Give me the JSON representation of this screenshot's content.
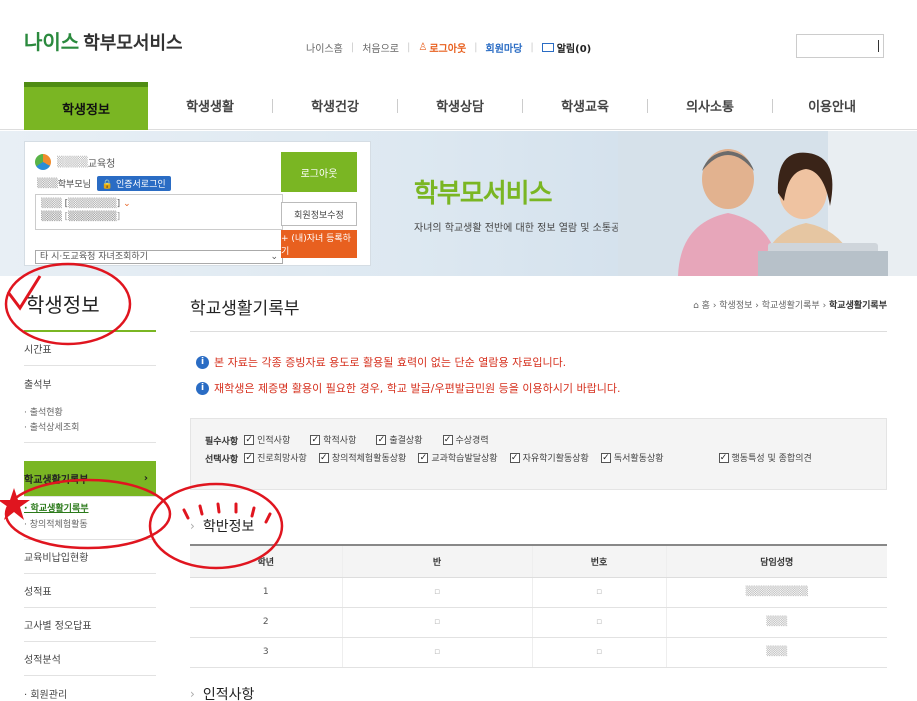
{
  "header": {
    "logo_neis": "나이스",
    "logo_service": "학부모서비스",
    "util": [
      "나이스홈",
      "처음으로",
      "로그아웃",
      "회원마당",
      "알림(0)"
    ]
  },
  "gnb": [
    "학생정보",
    "학생생활",
    "학생건강",
    "학생상담",
    "학생교육",
    "의사소통",
    "이용안내"
  ],
  "banner": {
    "edu_office": "교육청",
    "parent_label": "학부모님",
    "cert_login": "인증서로그인",
    "child1": "[",
    "child2": "[",
    "select_text": "타 시·도교육청 자녀조회하기",
    "logout": "로그아웃",
    "member_edit": "회원정보수정",
    "add_child": "+ (내)자녀 등록하기",
    "title": "학부모서비스",
    "subtitle": "자녀의 학교생활 전반에 대한 정보 열람 및 소통공간"
  },
  "lnb": {
    "title": "학생정보",
    "items": [
      "시간표",
      "출석부"
    ],
    "attendance_sub": [
      "· 출석현황",
      "· 출석상세조회"
    ],
    "active": "학교생활기록부",
    "active_sub_on": "· 학교생활기록부",
    "active_sub_off": "· 창의적체험활동",
    "more": [
      "교육비납입현황",
      "성적표",
      "고사별 정오답표",
      "성적분석",
      "· 회원관리"
    ]
  },
  "content": {
    "title": "학교생활기록부",
    "crumb": [
      "홈",
      "학생정보",
      "학교생활기록부",
      "학교생활기록부"
    ],
    "notice1": "본 자료는 각종 증빙자료 용도로 활용될 효력이 없는 단순 열람용 자료입니다.",
    "notice2": "재학생은 제증명 활용이 필요한 경우, 학교 발급/우편발급민원 등을 이용하시기 바랍니다.",
    "required_label": "필수사항",
    "required": [
      "인적사항",
      "학적사항",
      "출결상황",
      "수상경력"
    ],
    "optional_label": "선택사항",
    "optional": [
      "진로희망사항",
      "창의적체험활동상황",
      "교과학습발달상황",
      "자유학기활동상황",
      "독서활동상황",
      "행동특성 및 종합의견"
    ],
    "section1": "학반정보",
    "table_headers": [
      "학년",
      "반",
      "번호",
      "담임성명"
    ],
    "table_rows": [
      [
        "1",
        "",
        "",
        ""
      ],
      [
        "2",
        "",
        "",
        ""
      ],
      [
        "3",
        "",
        "",
        ""
      ]
    ],
    "section2": "인적사항"
  },
  "colors": {
    "accent_green": "#7ab623",
    "orange": "#e8601f",
    "blue": "#2a6cc4",
    "notice_red": "#d6301e",
    "annotation_red": "#e0151f"
  }
}
